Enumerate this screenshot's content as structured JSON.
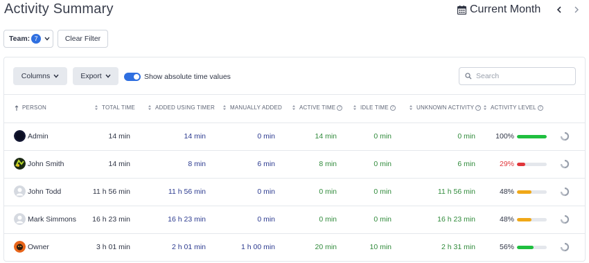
{
  "header": {
    "title": "Activity Summary",
    "period_label": "Current Month",
    "prev_icon": "chevron-left-icon",
    "next_icon": "chevron-right-icon"
  },
  "filters": {
    "team_label": "Team:",
    "team_count": "7",
    "clear_label": "Clear Filter"
  },
  "toolbar": {
    "columns_label": "Columns",
    "export_label": "Export",
    "toggle_on": true,
    "toggle_label": "Show absolute time values",
    "search_placeholder": "Search"
  },
  "table": {
    "headers": {
      "person": "Person",
      "total": "Total Time",
      "timer": "Added Using Timer",
      "manual": "Manually Added",
      "active": "Active Time",
      "idle": "Idle Time",
      "unknown": "Unknown Activity",
      "level": "Activity Level"
    },
    "rows": [
      {
        "name": "Admin",
        "total": "14 min",
        "timer": "14 min",
        "manual": "0 min",
        "active": "14 min",
        "idle": "0 min",
        "unknown": "0 min",
        "level_text": "100%",
        "level": 1.0,
        "level_color": "#1fbf3f",
        "avatar": "dark"
      },
      {
        "name": "John Smith",
        "total": "14 min",
        "timer": "8 min",
        "manual": "6 min",
        "active": "8 min",
        "idle": "0 min",
        "unknown": "6 min",
        "level_text": "29%",
        "level": 0.29,
        "level_color": "#e0353a",
        "avatar": "green"
      },
      {
        "name": "John Todd",
        "total": "11 h 56 min",
        "timer": "11 h 56 min",
        "manual": "0 min",
        "active": "0 min",
        "idle": "0 min",
        "unknown": "11 h 56 min",
        "level_text": "48%",
        "level": 0.48,
        "level_color": "#f0a818",
        "avatar": "placeholder"
      },
      {
        "name": "Mark Simmons",
        "total": "16 h 23 min",
        "timer": "16 h 23 min",
        "manual": "0 min",
        "active": "0 min",
        "idle": "0 min",
        "unknown": "16 h 23 min",
        "level_text": "48%",
        "level": 0.48,
        "level_color": "#f0a818",
        "avatar": "placeholder"
      },
      {
        "name": "Owner",
        "total": "3 h 01 min",
        "timer": "2 h 01 min",
        "manual": "1 h 00 min",
        "active": "20 min",
        "idle": "10 min",
        "unknown": "2 h 31 min",
        "level_text": "56%",
        "level": 0.56,
        "level_color": "#1fbf3f",
        "avatar": "orange"
      }
    ]
  },
  "colors": {
    "accent": "#2f6fe0",
    "timer_text": "#2b3a8f",
    "positive_text": "#2f8a3a",
    "low_text": "#e0353a"
  }
}
